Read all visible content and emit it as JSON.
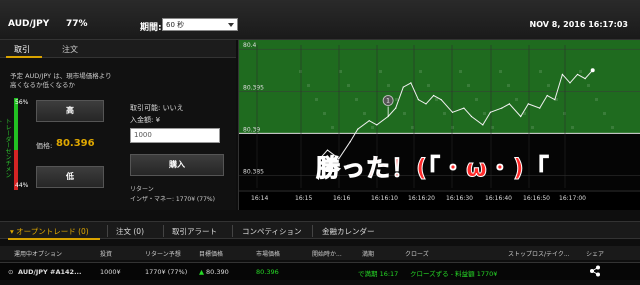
{
  "header": {
    "pair": "AUD/JPY",
    "payout_pct": "77%",
    "expiry_label": "期間:",
    "expiry_value": "60 秒",
    "datetime": "NOV 8, 2016 16:17:03"
  },
  "left_tabs": [
    {
      "label": "取引",
      "active": true
    },
    {
      "label": "注文",
      "active": false
    }
  ],
  "left_panel": {
    "description": "予定 AUD/JPY は、現市場価格より高くなるか低くなるか",
    "sentiment_label": "トレーダーセンチメント",
    "sentiment_high": "56%",
    "sentiment_low": "44%",
    "high_button": "高",
    "low_button": "低",
    "price_label": "価格:",
    "price_value": "80.396",
    "availability": "取引可能: いいえ",
    "amount_label": "入金額: ¥",
    "amount_placeholder": "1000",
    "buy_button": "購入",
    "return_label": "リターン",
    "insane_money": "インザ・マネー: 1770¥ (77%)"
  },
  "chart_data": {
    "type": "line",
    "y_ticks": [
      "80.4",
      "80.395",
      "80.39",
      "80.385"
    ],
    "x_ticks": [
      "16:14",
      "16:15",
      "16:16",
      "16:16:10",
      "16:16:20",
      "16:16:30",
      "16:16:40",
      "16:16:50",
      "16:17:00"
    ],
    "x": [
      "16:15:50",
      "16:15:52",
      "16:15:55",
      "16:15:58",
      "16:16:00",
      "16:16:03",
      "16:16:05",
      "16:16:08",
      "16:16:10",
      "16:16:12",
      "16:16:14",
      "16:16:16",
      "16:16:18",
      "16:16:20",
      "16:16:22",
      "16:16:25",
      "16:16:28",
      "16:16:30",
      "16:16:33",
      "16:16:35",
      "16:16:38",
      "16:16:40",
      "16:16:43",
      "16:16:45",
      "16:16:48",
      "16:16:50",
      "16:16:52",
      "16:16:54",
      "16:16:56",
      "16:16:58",
      "16:17:00",
      "16:17:02"
    ],
    "y": [
      80.387,
      80.388,
      80.387,
      80.389,
      80.3905,
      80.3915,
      80.391,
      80.392,
      80.393,
      80.3955,
      80.396,
      80.394,
      80.3935,
      80.3945,
      80.394,
      80.3925,
      80.393,
      80.392,
      80.391,
      80.3925,
      80.393,
      80.3935,
      80.392,
      80.3935,
      80.393,
      80.3945,
      80.394,
      80.397,
      80.396,
      80.397,
      80.3965,
      80.3975
    ],
    "entry_marker_label": "1",
    "winning_zone": "above"
  },
  "overlay_text": "勝った！(「・ω・)「",
  "bottom_tabs": [
    {
      "label": "オープントレード (0)",
      "active": true
    },
    {
      "label": "注文 (0)",
      "active": false
    },
    {
      "label": "取引アラート",
      "active": false
    },
    {
      "label": "コンペティション",
      "active": false
    },
    {
      "label": "金融カレンダー",
      "active": false
    }
  ],
  "table": {
    "headers": [
      "運用中オプション",
      "投資",
      "リターン予想",
      "目標価格",
      "市場価格",
      "開始時か...",
      "満期",
      "クローズ",
      "ストップロス/テイク...",
      "シェア"
    ],
    "row": {
      "option": "AUD/JPY #A142...",
      "investment": "1000¥",
      "expected_return": "1770¥ (77%)",
      "target_price": "80.390",
      "market_price": "80.396",
      "start": "",
      "expiry": "で満期 16:17",
      "close": "クローズずる - 料益額 1770¥",
      "stop_loss": "",
      "share": "share-icon"
    }
  },
  "colors": {
    "accent": "#d9a300",
    "up": "#22c022",
    "down": "#d42424",
    "overlay": "#ff2a2a"
  }
}
